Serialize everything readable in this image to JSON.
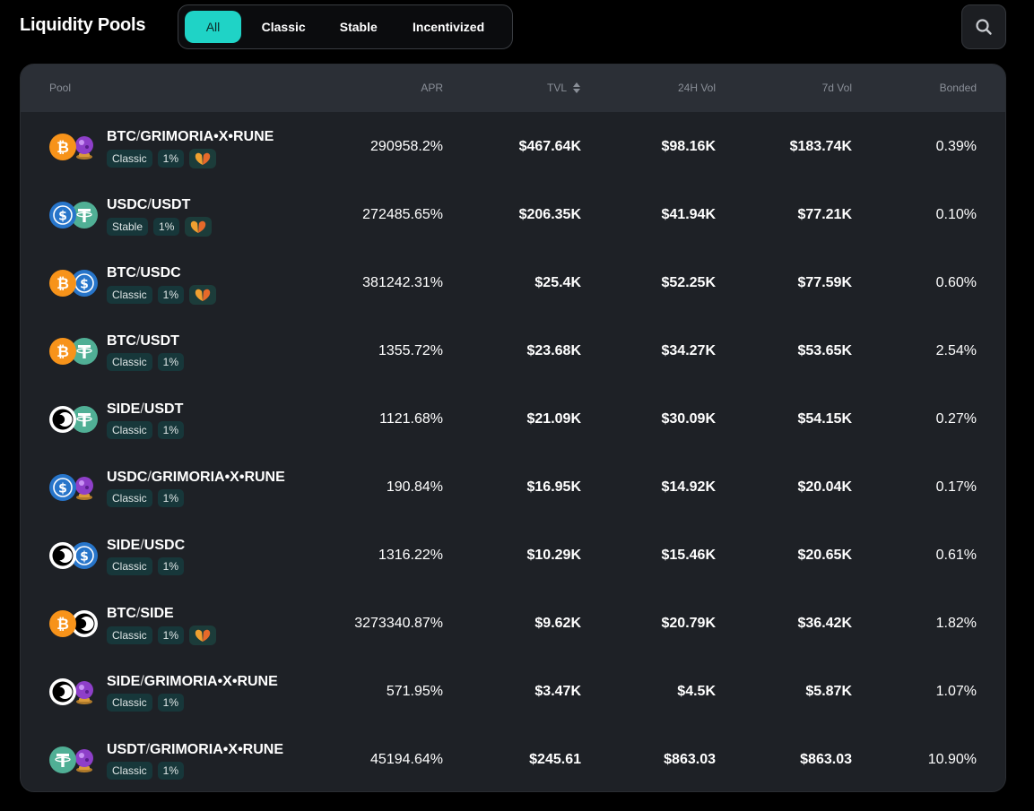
{
  "header": {
    "title": "Liquidity Pools",
    "filters": [
      {
        "label": "All",
        "active": true
      },
      {
        "label": "Classic",
        "active": false
      },
      {
        "label": "Stable",
        "active": false
      },
      {
        "label": "Incentivized",
        "active": false
      }
    ],
    "search_icon": "search-icon"
  },
  "table": {
    "columns": {
      "pool": "Pool",
      "apr": "APR",
      "tvl": "TVL",
      "vol24h": "24H Vol",
      "vol7d": "7d Vol",
      "bonded": "Bonded"
    },
    "rows": [
      {
        "base": "BTC",
        "sep": "/",
        "quote": "GRIMORIA•X•RUNE",
        "tokens": [
          "btc",
          "grimoria"
        ],
        "type": "Classic",
        "fee": "1%",
        "incentivized": true,
        "apr": "290958.2%",
        "tvl": "$467.64K",
        "vol24h": "$98.16K",
        "vol7d": "$183.74K",
        "bonded": "0.39%"
      },
      {
        "base": "USDC",
        "sep": "/",
        "quote": "USDT",
        "tokens": [
          "usdc",
          "usdt"
        ],
        "type": "Stable",
        "fee": "1%",
        "incentivized": true,
        "apr": "272485.65%",
        "tvl": "$206.35K",
        "vol24h": "$41.94K",
        "vol7d": "$77.21K",
        "bonded": "0.10%"
      },
      {
        "base": "BTC",
        "sep": "/",
        "quote": "USDC",
        "tokens": [
          "btc",
          "usdc"
        ],
        "type": "Classic",
        "fee": "1%",
        "incentivized": true,
        "apr": "381242.31%",
        "tvl": "$25.4K",
        "vol24h": "$52.25K",
        "vol7d": "$77.59K",
        "bonded": "0.60%"
      },
      {
        "base": "BTC",
        "sep": "/",
        "quote": "USDT",
        "tokens": [
          "btc",
          "usdt"
        ],
        "type": "Classic",
        "fee": "1%",
        "incentivized": false,
        "apr": "1355.72%",
        "tvl": "$23.68K",
        "vol24h": "$34.27K",
        "vol7d": "$53.65K",
        "bonded": "2.54%"
      },
      {
        "base": "SIDE",
        "sep": "/",
        "quote": "USDT",
        "tokens": [
          "side",
          "usdt"
        ],
        "type": "Classic",
        "fee": "1%",
        "incentivized": false,
        "apr": "1121.68%",
        "tvl": "$21.09K",
        "vol24h": "$30.09K",
        "vol7d": "$54.15K",
        "bonded": "0.27%"
      },
      {
        "base": "USDC",
        "sep": "/",
        "quote": "GRIMORIA•X•RUNE",
        "tokens": [
          "usdc",
          "grimoria"
        ],
        "type": "Classic",
        "fee": "1%",
        "incentivized": false,
        "apr": "190.84%",
        "tvl": "$16.95K",
        "vol24h": "$14.92K",
        "vol7d": "$20.04K",
        "bonded": "0.17%"
      },
      {
        "base": "SIDE",
        "sep": "/",
        "quote": "USDC",
        "tokens": [
          "side",
          "usdc"
        ],
        "type": "Classic",
        "fee": "1%",
        "incentivized": false,
        "apr": "1316.22%",
        "tvl": "$10.29K",
        "vol24h": "$15.46K",
        "vol7d": "$20.65K",
        "bonded": "0.61%"
      },
      {
        "base": "BTC",
        "sep": "/",
        "quote": "SIDE",
        "tokens": [
          "btc",
          "side"
        ],
        "type": "Classic",
        "fee": "1%",
        "incentivized": true,
        "apr": "3273340.87%",
        "tvl": "$9.62K",
        "vol24h": "$20.79K",
        "vol7d": "$36.42K",
        "bonded": "1.82%"
      },
      {
        "base": "SIDE",
        "sep": "/",
        "quote": "GRIMORIA•X•RUNE",
        "tokens": [
          "side",
          "grimoria"
        ],
        "type": "Classic",
        "fee": "1%",
        "incentivized": false,
        "apr": "571.95%",
        "tvl": "$3.47K",
        "vol24h": "$4.5K",
        "vol7d": "$5.87K",
        "bonded": "1.07%"
      },
      {
        "base": "USDT",
        "sep": "/",
        "quote": "GRIMORIA•X•RUNE",
        "tokens": [
          "usdt",
          "grimoria"
        ],
        "type": "Classic",
        "fee": "1%",
        "incentivized": false,
        "apr": "45194.64%",
        "tvl": "$245.61",
        "vol24h": "$863.03",
        "vol7d": "$863.03",
        "bonded": "10.90%"
      }
    ]
  },
  "colors": {
    "accent": "#1fd3c6",
    "btc": "#f7931a",
    "usdc": "#2775ca",
    "usdt": "#50af95",
    "side": "#ffffff",
    "grimoria": "#8e3fc9",
    "incentive": "#f0a030"
  }
}
